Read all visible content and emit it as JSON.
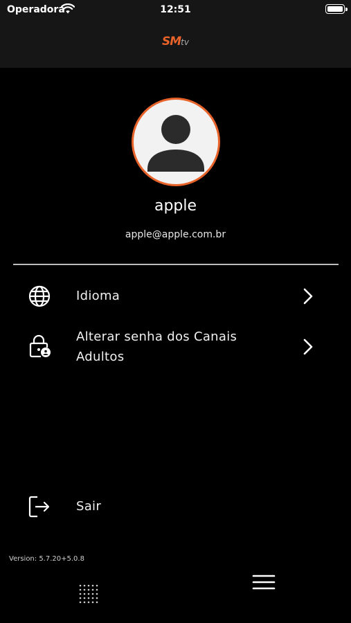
{
  "status_bar": {
    "carrier": "Operadora",
    "time": "12:51"
  },
  "header": {
    "logo_main": "SM",
    "logo_suffix": "tv"
  },
  "profile": {
    "name": "apple",
    "email": "apple@apple.com.br",
    "avatar_icon": "user-silhouette-icon",
    "accent_color": "#e8632a"
  },
  "menu": {
    "items": [
      {
        "label": "Idioma",
        "icon": "globe-icon"
      },
      {
        "label_line1": "Alterar senha dos Canais",
        "label_line2": "Adultos",
        "icon": "lock-icon"
      }
    ],
    "logout": {
      "label": "Sair",
      "icon": "logout-icon"
    }
  },
  "footer": {
    "version": "Version: 5.7.20+5.0.8"
  }
}
